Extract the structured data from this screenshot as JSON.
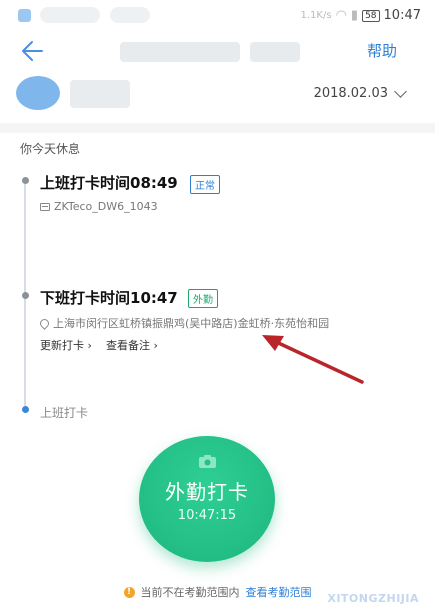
{
  "status_bar": {
    "time": "10:47",
    "battery": "58",
    "signal_text": "1.1K/s"
  },
  "nav": {
    "help_label": "帮助"
  },
  "header": {
    "date": "2018.02.03"
  },
  "day_note": "你今天休息",
  "records": [
    {
      "title": "上班打卡时间08:49",
      "tag": "正常",
      "device": "ZKTeco_DW6_1043"
    },
    {
      "title": "下班打卡时间10:47",
      "tag": "外勤",
      "location": "上海市闵行区虹桥镇振鼎鸡(吴中路店)金虹桥·东苑怡和园",
      "update_label": "更新打卡",
      "notes_label": "查看备注"
    }
  ],
  "next_step": "上班打卡",
  "punch_button": {
    "label": "外勤打卡",
    "time": "10:47:15"
  },
  "footer": {
    "message": "当前不在考勤范围内",
    "link": "查看考勤范围"
  },
  "watermark": "XITONGZHIJIA",
  "colors": {
    "accent_blue": "#2d7fd6",
    "accent_green": "#1db67e",
    "warning": "#f0a62a",
    "arrow": "#b8262c"
  }
}
